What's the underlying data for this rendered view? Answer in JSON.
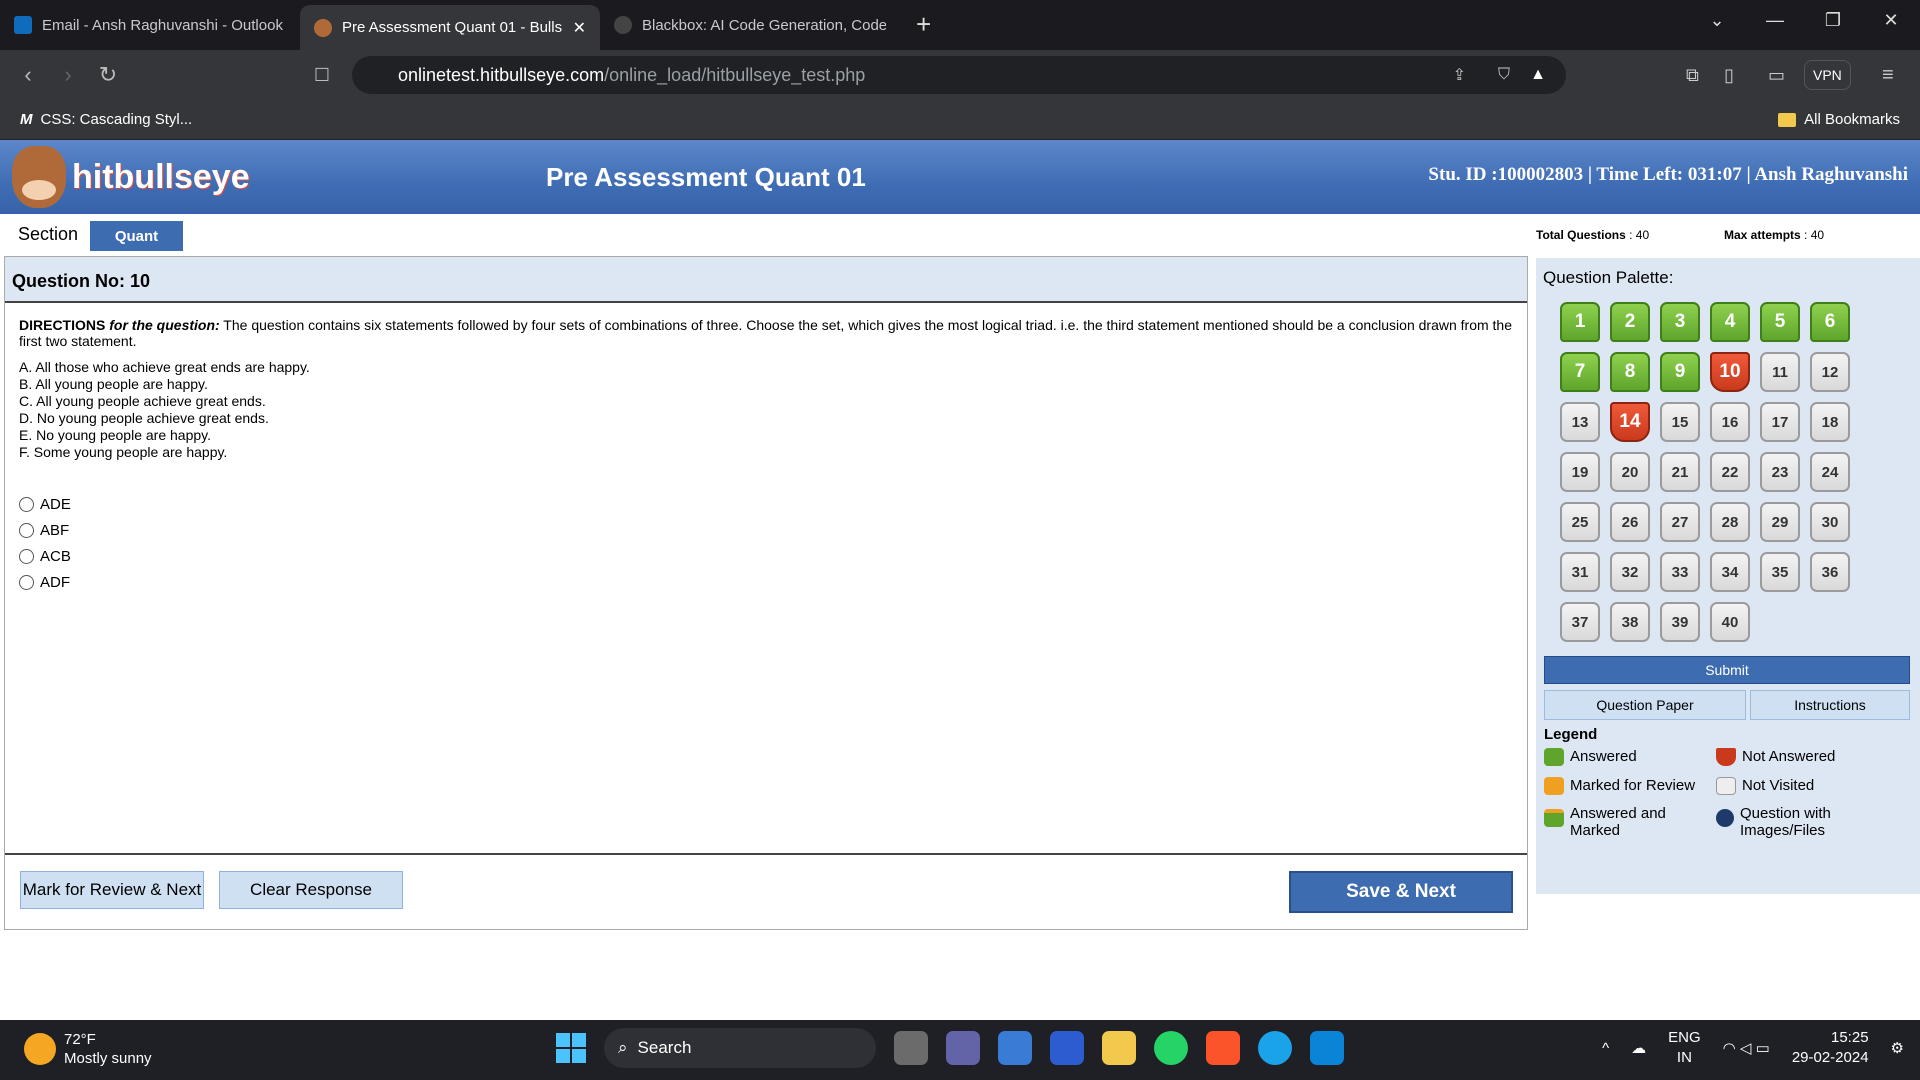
{
  "browser": {
    "tabs": [
      {
        "label": "Email - Ansh Raghuvanshi - Outlook",
        "active": false
      },
      {
        "label": "Pre Assessment Quant 01 - Bulls",
        "active": true
      },
      {
        "label": "Blackbox: AI Code Generation, Code",
        "active": false
      }
    ],
    "url_host": "onlinetest.hitbullseye.com",
    "url_path": "/online_load/hitbullseye_test.php",
    "vpn_label": "VPN",
    "bookmark": "CSS: Cascading Styl...",
    "all_bookmarks": "All Bookmarks"
  },
  "exam": {
    "logo_text": "hitbullseye",
    "title": "Pre Assessment Quant 01",
    "student_info": "Stu. ID  :100002803 | Time Left: 031:07 | Ansh Raghuvanshi",
    "section_label": "Section",
    "section_name": "Quant",
    "total_questions_label": "Total Questions",
    "total_questions": ": 40",
    "max_attempts_label": "Max attempts",
    "max_attempts": ": 40"
  },
  "question": {
    "number_label": "Question No: 10",
    "directions_lead": "DIRECTIONS",
    "directions_italic": "for the question:",
    "directions_text": " The question contains six statements followed by four sets of combinations of three. Choose the set, which gives  the most logical triad. i.e. the third statement mentioned should be a conclusion drawn from the first two statement.",
    "statements": [
      "A. All those who achieve great ends are happy.",
      "B. All young people are happy.",
      "C. All young people achieve great ends.",
      "D. No young people achieve great ends.",
      "E. No young people are happy.",
      "F. Some young people are happy."
    ],
    "options": [
      "ADE",
      "ABF",
      "ACB",
      "ADF"
    ]
  },
  "actions": {
    "mark_review": "Mark for Review & Next",
    "clear": "Clear Response",
    "save_next": "Save & Next"
  },
  "palette": {
    "title": "Question Palette:",
    "answered": [
      "1",
      "2",
      "3",
      "4",
      "5",
      "6",
      "7",
      "8",
      "9"
    ],
    "not_answered": [
      "10",
      "14"
    ],
    "not_visited": [
      "11",
      "12",
      "13",
      "15",
      "16",
      "17",
      "18",
      "19",
      "20",
      "21",
      "22",
      "23",
      "24",
      "25",
      "26",
      "27",
      "28",
      "29",
      "30",
      "31",
      "32",
      "33",
      "34",
      "35",
      "36",
      "37",
      "38",
      "39",
      "40"
    ],
    "submit": "Submit",
    "question_paper": "Question Paper",
    "instructions": "Instructions"
  },
  "legend": {
    "title": "Legend",
    "answered": "Answered",
    "not_answered": "Not Answered",
    "marked": "Marked for Review",
    "not_visited": "Not Visited",
    "answered_marked": "Answered and Marked",
    "with_images": "Question with Images/Files"
  },
  "taskbar": {
    "temp": "72°F",
    "weather": "Mostly sunny",
    "search": "Search",
    "lang1": "ENG",
    "lang2": "IN",
    "time": "15:25",
    "date": "29-02-2024"
  },
  "colors": {
    "header_blue": "#3f6db4",
    "answered_green": "#5fa52c",
    "not_answered_red": "#c93a1c",
    "marked_orange": "#f0a020"
  }
}
